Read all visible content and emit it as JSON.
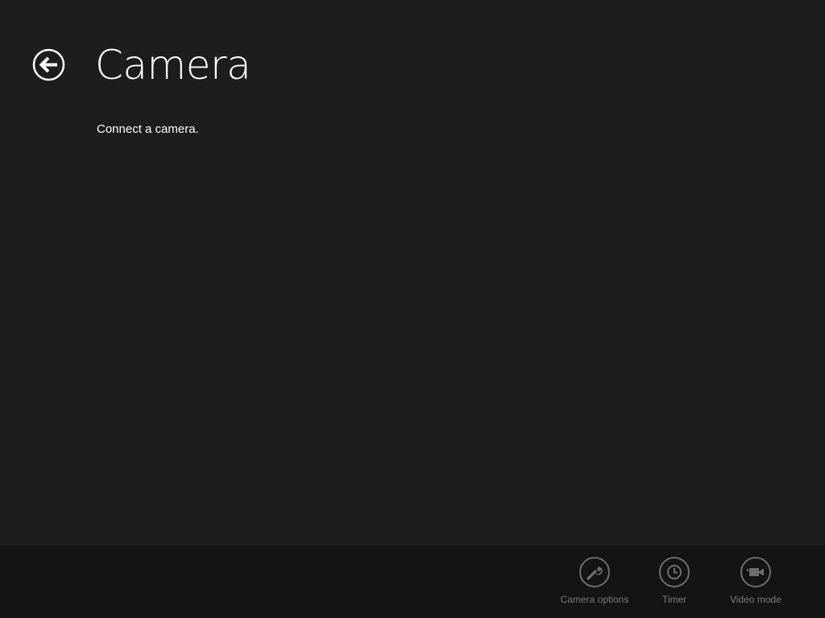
{
  "header": {
    "title": "Camera",
    "back_icon": "back-arrow-icon"
  },
  "main": {
    "message": "Connect a camera."
  },
  "app_bar": {
    "buttons": [
      {
        "label": "Camera options",
        "icon": "wrench-icon",
        "enabled": false
      },
      {
        "label": "Timer",
        "icon": "clock-icon",
        "enabled": false
      },
      {
        "label": "Video mode",
        "icon": "video-camera-icon",
        "enabled": false
      }
    ]
  },
  "colors": {
    "background": "#1d1d1d",
    "app_bar_background": "#141414",
    "text": "#ffffff",
    "disabled": "#6d6d6d"
  }
}
